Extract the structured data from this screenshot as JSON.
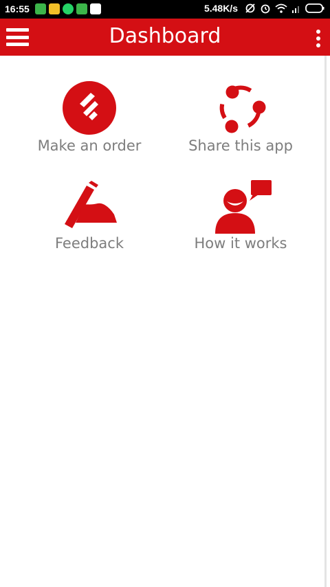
{
  "status_bar": {
    "time": "16:55",
    "net_speed": "5.48K/s",
    "notification_icons": [
      "wechat-icon",
      "file-icon",
      "whatsapp-icon",
      "wechat-icon",
      "play-store-icon"
    ],
    "notification_colors": [
      "#3cb54a",
      "#f2c028",
      "#25d366",
      "#3cb54a",
      "#ffffff"
    ],
    "right_icons": [
      "sync-off-icon",
      "alarm-icon",
      "wifi-icon",
      "signal-icon",
      "battery-icon"
    ]
  },
  "app_bar": {
    "title": "Dashboard",
    "menu_icon": "hamburger-menu-icon",
    "overflow_icon": "overflow-menu-icon"
  },
  "colors": {
    "accent": "#d40f14",
    "label_gray": "#7d7d7d"
  },
  "tiles": [
    {
      "label": "Make an order",
      "icon": "order-icon"
    },
    {
      "label": "Share this app",
      "icon": "share-icon"
    },
    {
      "label": "Feedback",
      "icon": "feedback-icon"
    },
    {
      "label": "How it works",
      "icon": "how-it-works-icon"
    }
  ]
}
